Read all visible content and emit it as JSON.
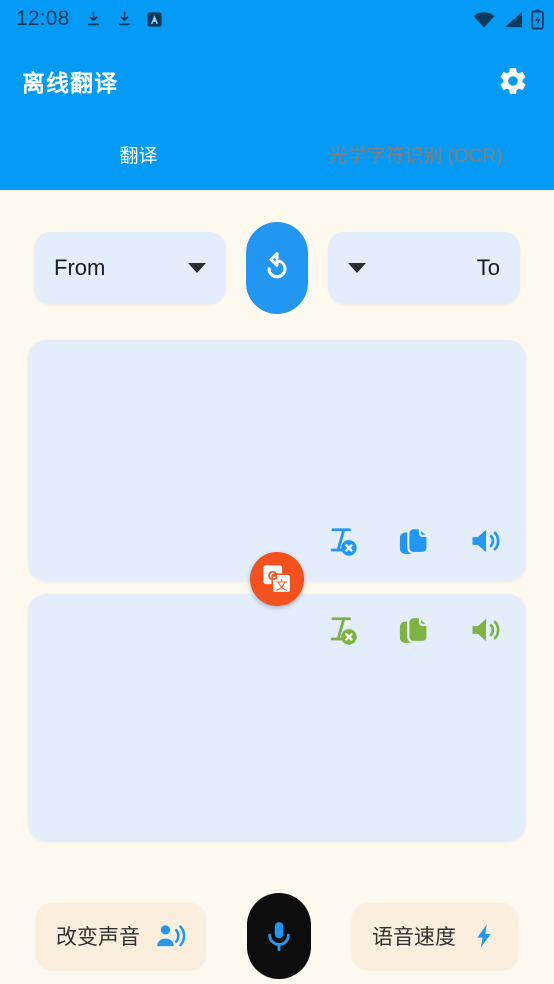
{
  "status_bar": {
    "time": "12:08",
    "left_icons": [
      "download-icon",
      "download-icon",
      "app-badge-a-icon"
    ],
    "right_icons": [
      "wifi-icon",
      "cellular-signal-icon",
      "battery-charging-icon"
    ]
  },
  "app_bar": {
    "title": "离线翻译",
    "settings_icon": "gear-icon",
    "background_color": "#039bf5"
  },
  "tabs": [
    {
      "label": "翻译",
      "active": true
    },
    {
      "label": "光学字符识别 (OCR)",
      "active": false
    }
  ],
  "language_row": {
    "from": {
      "label": "From",
      "icon": "chevron-down-icon"
    },
    "to": {
      "label": "To",
      "icon": "chevron-down-icon"
    },
    "swap": {
      "icon": "swap-rotate-icon",
      "color": "#2196f3"
    }
  },
  "source_card": {
    "text": "",
    "placeholder": "",
    "icon_color": "#2196f3",
    "actions": [
      {
        "name": "clear-text-icon",
        "label": "清除"
      },
      {
        "name": "copy-icon",
        "label": "复制"
      },
      {
        "name": "speaker-icon",
        "label": "朗读"
      }
    ]
  },
  "target_card": {
    "text": "",
    "icon_color": "#7cb342",
    "actions": [
      {
        "name": "clear-text-icon",
        "label": "清除"
      },
      {
        "name": "copy-icon",
        "label": "复制"
      },
      {
        "name": "speaker-icon",
        "label": "朗读"
      }
    ]
  },
  "translate_fab": {
    "icon": "google-translate-icon",
    "color": "#f4511e"
  },
  "bottom_bar": {
    "change_voice": {
      "label": "改变声音",
      "icon": "person-speaking-icon"
    },
    "mic": {
      "icon": "microphone-icon",
      "color": "#0d0d0d"
    },
    "speech_speed": {
      "label": "语音速度",
      "icon": "lightning-bolt-icon"
    }
  },
  "colors": {
    "accent_blue": "#039bf5",
    "card_blue": "#e4edfc",
    "page_bg": "#fdf9ee",
    "pill_cream": "#faefdd",
    "green": "#7cb342",
    "orange": "#f4511e"
  }
}
